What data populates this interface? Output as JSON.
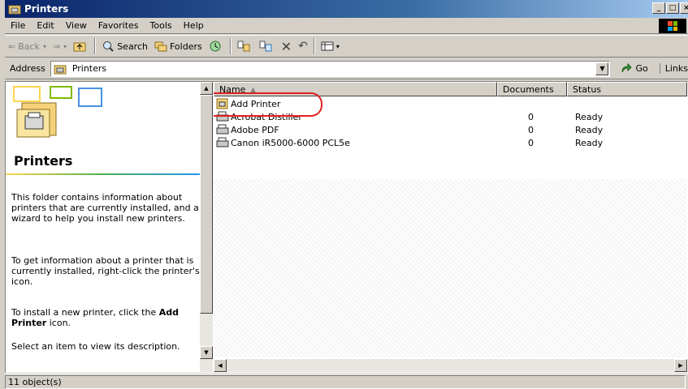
{
  "window": {
    "title": "Printers"
  },
  "menubar": {
    "items": [
      {
        "label": "File"
      },
      {
        "label": "Edit"
      },
      {
        "label": "View"
      },
      {
        "label": "Favorites"
      },
      {
        "label": "Tools"
      },
      {
        "label": "Help"
      }
    ]
  },
  "toolbar": {
    "back_label": "Back",
    "search_label": "Search",
    "folders_label": "Folders"
  },
  "address": {
    "label": "Address",
    "value": "Printers",
    "go_label": "Go",
    "links_label": "Links"
  },
  "leftpane": {
    "heading": "Printers",
    "para1": "This folder contains information about printers that are currently installed, and a wizard to help you install new printers.",
    "para2": "To get information about a printer that is currently installed, right-click the printer's icon.",
    "para3_prefix": "To install a new printer, click the",
    "para3_bold": "Add Printer",
    "para3_suffix": "icon.",
    "para4": "Select an item to view its description."
  },
  "list": {
    "columns": [
      "Name",
      "Documents",
      "Status"
    ],
    "rows": [
      {
        "name": "Add Printer",
        "documents": "",
        "status": ""
      },
      {
        "name": "Acrobat Distiller",
        "documents": "0",
        "status": "Ready"
      },
      {
        "name": "Adobe PDF",
        "documents": "0",
        "status": "Ready"
      },
      {
        "name": "Canon iR5000-6000 PCL5e",
        "documents": "0",
        "status": "Ready"
      }
    ]
  },
  "statusbar": {
    "text": "11 object(s)"
  },
  "colors": {
    "highlight": "#e02020",
    "titlebar": "#0a246a"
  }
}
